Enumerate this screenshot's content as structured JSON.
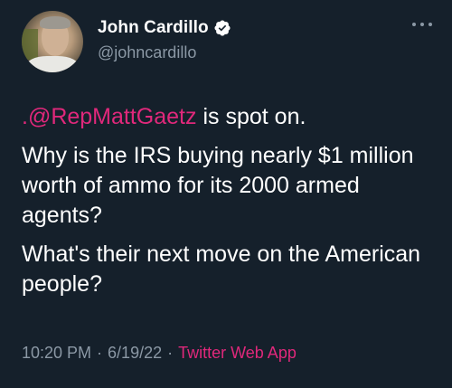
{
  "author": {
    "display_name": "John Cardillo",
    "handle": "@johncardillo",
    "verified": true
  },
  "tweet": {
    "mention": ".@RepMattGaetz",
    "line1_rest": " is spot on.",
    "line2": "Why is the IRS buying nearly $1 million worth of ammo for its 2000 armed agents?",
    "line3": "What's their next move on the American people?"
  },
  "meta": {
    "time": "10:20 PM",
    "separator1": "·",
    "date": "6/19/22",
    "separator2": "·",
    "source": "Twitter Web App"
  },
  "colors": {
    "background": "#15202b",
    "accent": "#e0287b",
    "secondary_text": "#8b98a5",
    "verified_badge": "#ffffff"
  },
  "icons": {
    "verified": "verified-badge-icon",
    "more": "more-options-icon"
  }
}
